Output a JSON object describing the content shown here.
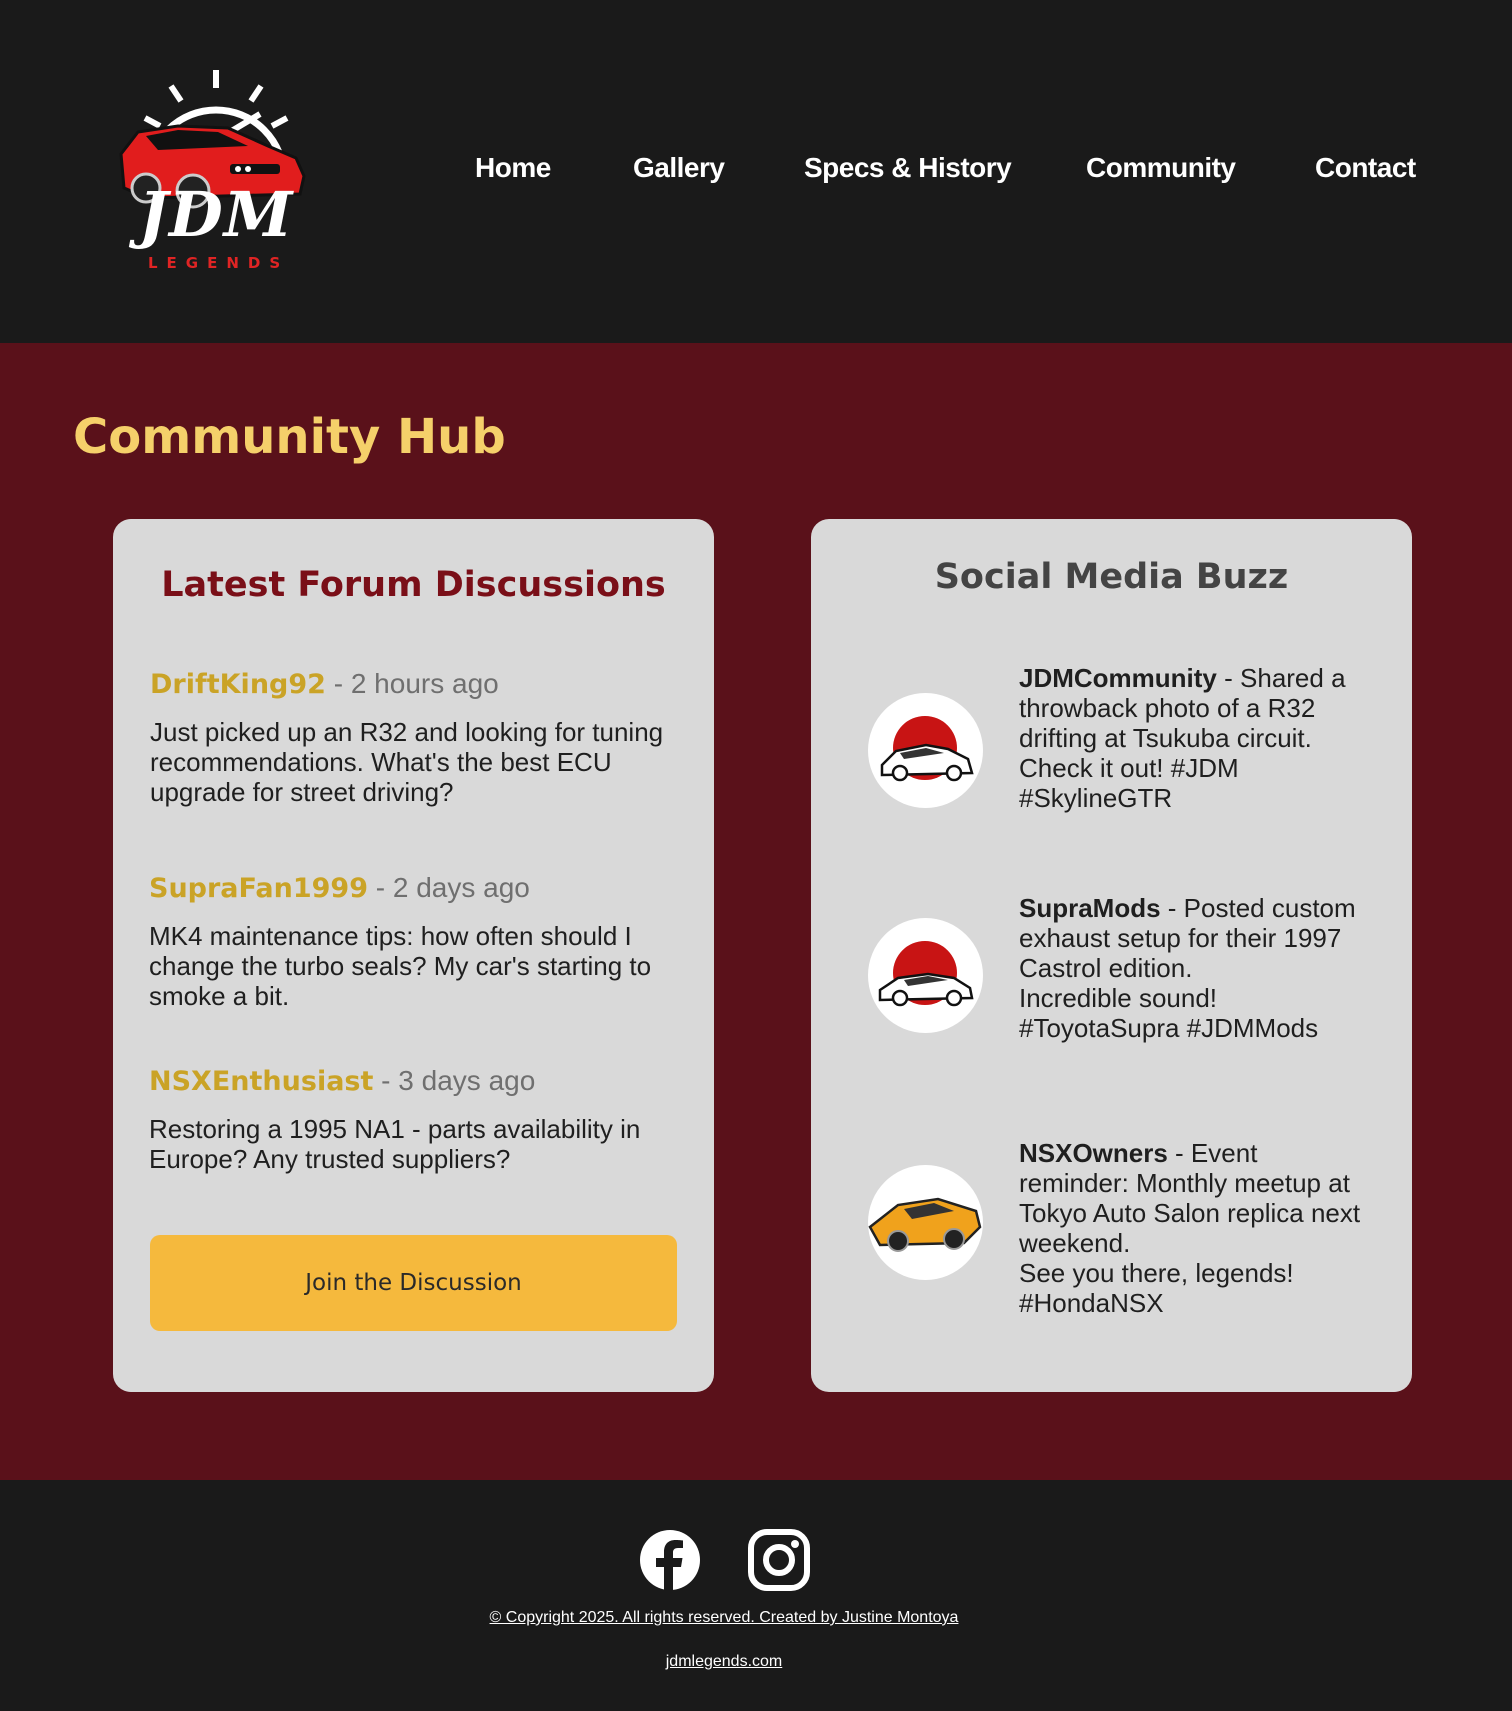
{
  "logo": {
    "main": "JDM",
    "sub": "LEGENDS"
  },
  "nav": [
    {
      "label": "Home"
    },
    {
      "label": "Gallery"
    },
    {
      "label": "Specs & History"
    },
    {
      "label": "Community"
    },
    {
      "label": "Contact"
    }
  ],
  "hub": {
    "title": "Community Hub"
  },
  "forum": {
    "title": "Latest Forum Discussions",
    "posts": [
      {
        "user": "DriftKing92",
        "time": " - 2 hours ago",
        "body": "Just picked up an R32 and looking for tuning recommendations. What's the best ECU upgrade for street driving?"
      },
      {
        "user": "SupraFan1999",
        "time": " - 2 days ago",
        "body": "MK4 maintenance tips: how often should I change the turbo seals? My car's starting to smoke a bit."
      },
      {
        "user": "NSXEnthusiast",
        "time": " - 3 days ago",
        "body": "Restoring a 1995 NA1 - parts availability in Europe? Any trusted suppliers?"
      }
    ],
    "join_label": "Join the Discussion"
  },
  "social": {
    "title": "Social Media Buzz",
    "items": [
      {
        "user": "JDMCommunity",
        "text": " - Shared a throwback photo of a R32 drifting at Tsukuba circuit. Check it out! #JDM #SkylineGTR"
      },
      {
        "user": "SupraMods",
        "text": " - Posted custom exhaust setup for their 1997 Castrol edition.",
        "text2": "Incredible sound! #ToyotaSupra #JDMMods"
      },
      {
        "user": "NSXOwners",
        "text": " - Event reminder: Monthly meetup at Tokyo Auto Salon replica next weekend.",
        "text2": "See you there, legends! #HondaNSX"
      }
    ]
  },
  "footer": {
    "copyright": "© Copyright 2025. All rights reserved. Created by Justine Montoya",
    "site": "jdmlegends.com"
  },
  "colors": {
    "header_bg": "#1a1a1a",
    "main_bg": "#5a111a",
    "accent_yellow": "#f5d06a",
    "button": "#f5b93d",
    "username": "#caa326",
    "card_bg": "#d9d9d9"
  }
}
